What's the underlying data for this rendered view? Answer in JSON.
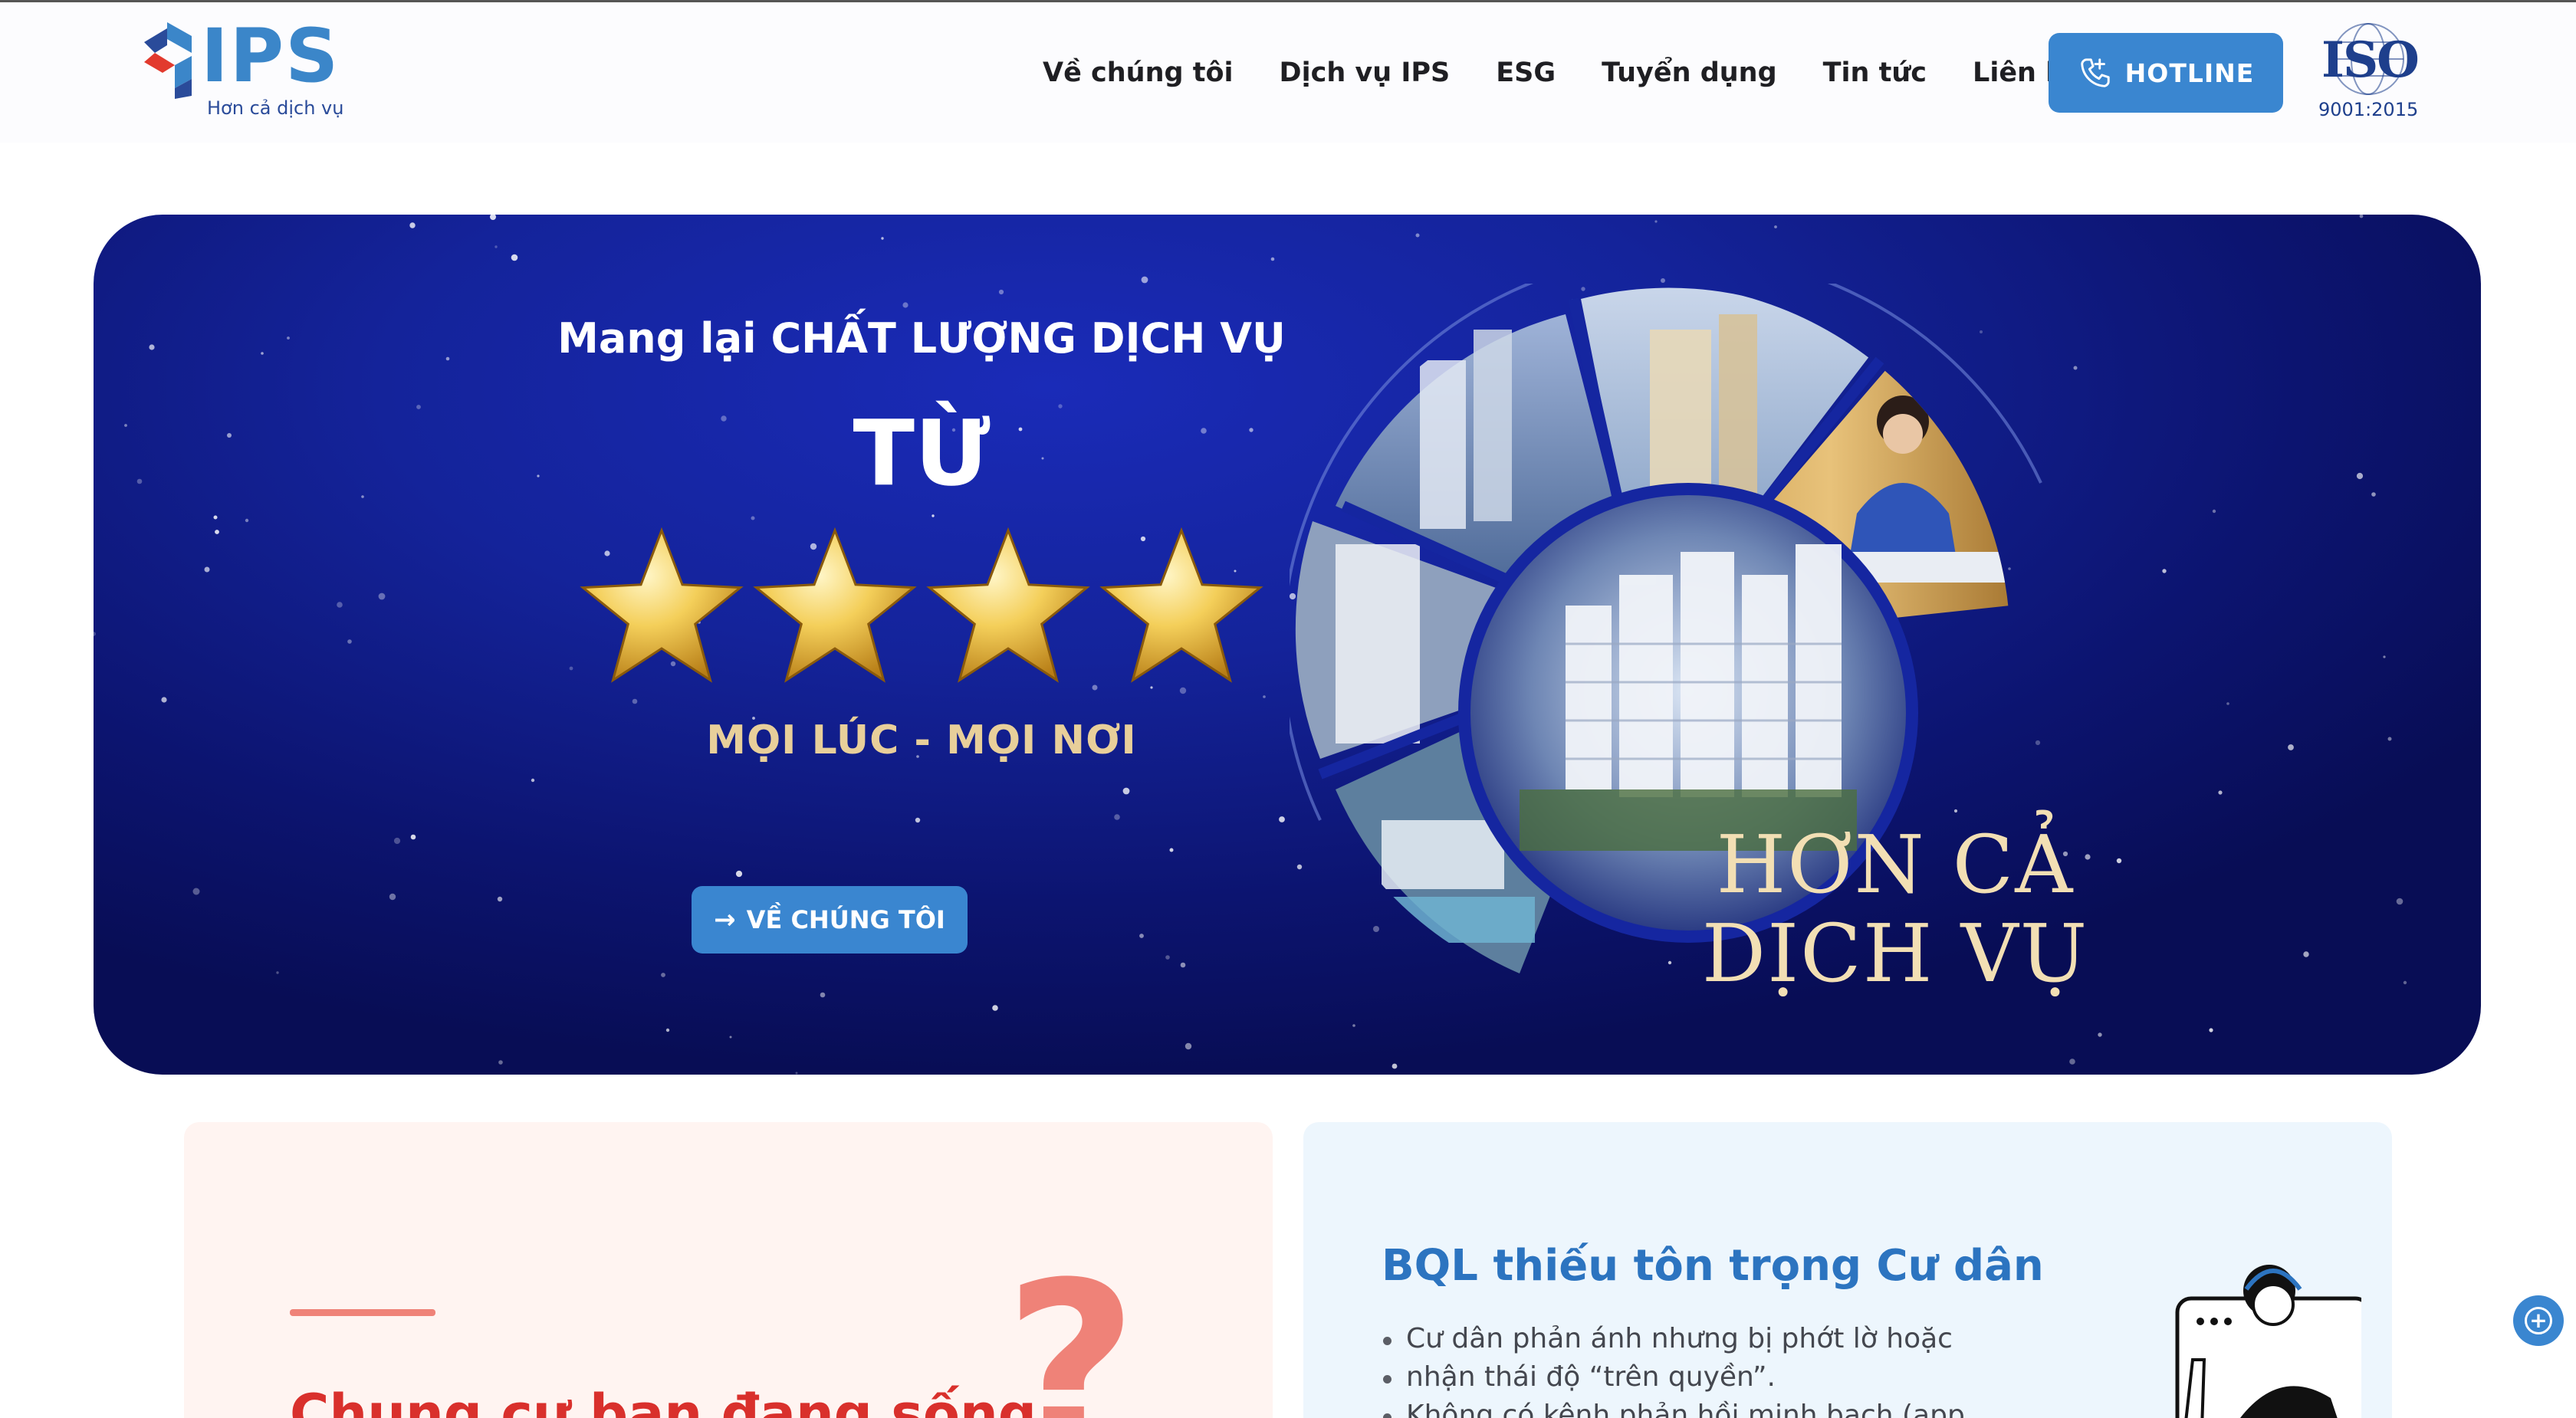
{
  "brand": {
    "name": "IPS",
    "tagline": "Hơn cả dịch vụ"
  },
  "nav": {
    "items": [
      "Về chúng tôi",
      "Dịch vụ IPS",
      "ESG",
      "Tuyển dụng",
      "Tin tức",
      "Liên hệ"
    ]
  },
  "hotline": {
    "label": "HOTLINE",
    "icon": "phone-call-icon"
  },
  "certification": {
    "badge": "ISO",
    "standard": "9001:2015"
  },
  "hero": {
    "headline": "Mang lại CHẤT LƯỢNG DỊCH VỤ",
    "from": "TỪ",
    "star_rating": 4,
    "subheadline": "MỌI LÚC - MỌI NƠI",
    "cta_arrow": "→",
    "cta_label": "VỀ CHÚNG TÔI",
    "slogan_line1": "HƠN CẢ",
    "slogan_line2": "DỊCH VỤ"
  },
  "card_left": {
    "heading": "Chung cư bạn đang sống",
    "decoration": "?"
  },
  "card_right": {
    "heading": "BQL thiếu tôn trọng Cư dân",
    "bullets": [
      "Cư dân phản ánh nhưng bị phớt lờ hoặc",
      "nhận thái độ “trên quyền”.",
      "Không có kênh phản hồi minh bạch (app,"
    ]
  },
  "colors": {
    "brand_blue": "#3a86d0",
    "hero_navy": "#14239a",
    "gold": "#e8cf9a",
    "alert_red": "#d9302c"
  }
}
